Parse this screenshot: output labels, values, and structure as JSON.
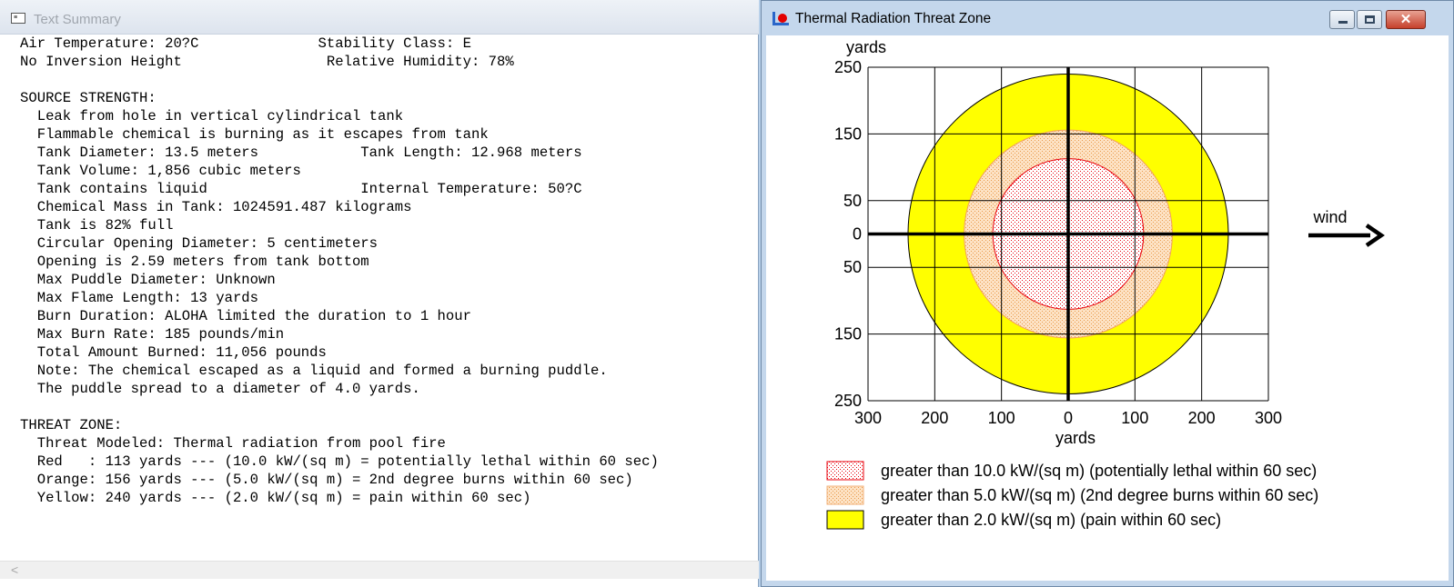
{
  "text_window": {
    "title": "Text Summary",
    "lines": [
      "Air Temperature: 20?C              Stability Class: E",
      "No Inversion Height                 Relative Humidity: 78%",
      "",
      "SOURCE STRENGTH:",
      "  Leak from hole in vertical cylindrical tank",
      "  Flammable chemical is burning as it escapes from tank",
      "  Tank Diameter: 13.5 meters            Tank Length: 12.968 meters",
      "  Tank Volume: 1,856 cubic meters",
      "  Tank contains liquid                  Internal Temperature: 50?C",
      "  Chemical Mass in Tank: 1024591.487 kilograms",
      "  Tank is 82% full",
      "  Circular Opening Diameter: 5 centimeters",
      "  Opening is 2.59 meters from tank bottom",
      "  Max Puddle Diameter: Unknown",
      "  Max Flame Length: 13 yards",
      "  Burn Duration: ALOHA limited the duration to 1 hour",
      "  Max Burn Rate: 185 pounds/min",
      "  Total Amount Burned: 11,056 pounds",
      "  Note: The chemical escaped as a liquid and formed a burning puddle.",
      "  The puddle spread to a diameter of 4.0 yards.",
      "",
      "THREAT ZONE:",
      "  Threat Modeled: Thermal radiation from pool fire",
      "  Red   : 113 yards --- (10.0 kW/(sq m) = potentially lethal within 60 sec)",
      "  Orange: 156 yards --- (5.0 kW/(sq m) = 2nd degree burns within 60 sec)",
      "  Yellow: 240 yards --- (2.0 kW/(sq m) = pain within 60 sec)"
    ],
    "scroll_left_glyph": "<"
  },
  "chart_window": {
    "title": "Thermal Radiation Threat Zone",
    "buttons": {
      "minimize": "",
      "maximize": "",
      "close": "✕"
    },
    "icon": "threat-zone-app-icon"
  },
  "chart_data": {
    "type": "area",
    "ylabel": "yards",
    "xlabel": "yards",
    "xlim": [
      -300,
      300
    ],
    "ylim": [
      -250,
      250
    ],
    "x_tick_labels": [
      "300",
      "200",
      "100",
      "0",
      "100",
      "200",
      "300"
    ],
    "y_tick_labels": [
      "250",
      "150",
      "50",
      "0",
      "50",
      "150",
      "250"
    ],
    "wind_label": "wind",
    "grid": true,
    "zones": [
      {
        "name": "Red",
        "radius": 113,
        "color": "#e8000b",
        "pattern": "red-dots",
        "legend": "greater than 10.0 kW/(sq m) (potentially lethal within 60 sec)"
      },
      {
        "name": "Orange",
        "radius": 156,
        "color": "#f7c08a",
        "pattern": "orange-dots",
        "legend": "greater than 5.0 kW/(sq m) (2nd degree burns within 60 sec)"
      },
      {
        "name": "Yellow",
        "radius": 240,
        "color": "#ffff00",
        "pattern": "solid",
        "legend": "greater than 2.0 kW/(sq m) (pain within 60 sec)"
      }
    ]
  }
}
